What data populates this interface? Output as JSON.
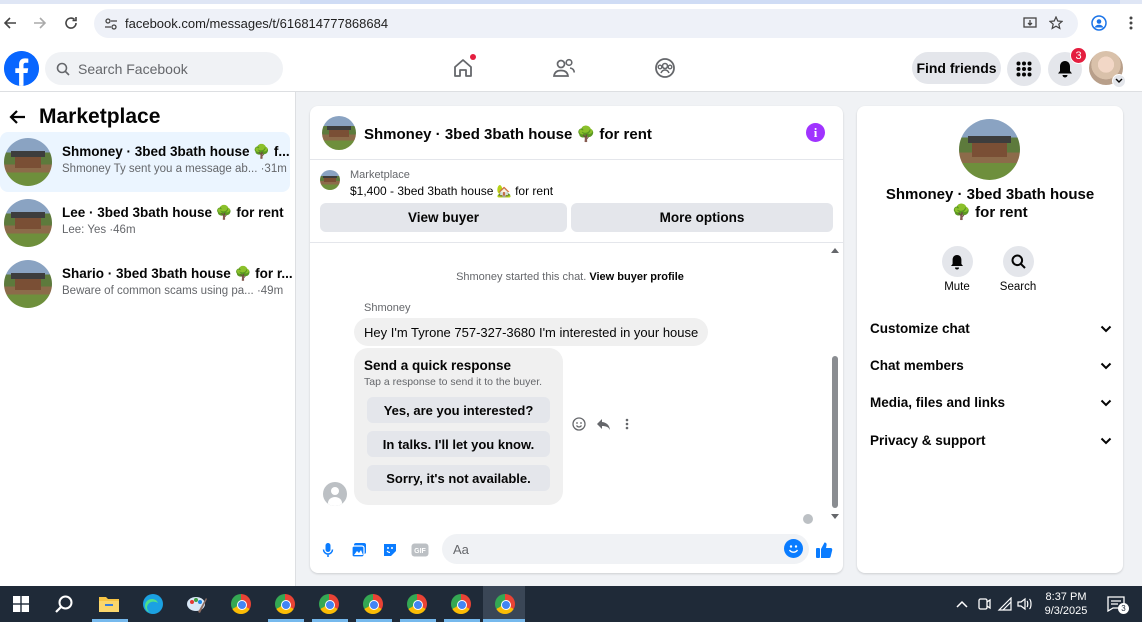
{
  "browser": {
    "url": "facebook.com/messages/t/616814777868684"
  },
  "header": {
    "search_placeholder": "Search Facebook",
    "find_friends": "Find friends",
    "notifications_count": "3"
  },
  "left_panel": {
    "title": "Marketplace",
    "chats": [
      {
        "name": "Shmoney · 3bed 3bath house 🌳 f...",
        "sub": "Shmoney Ty sent you a message ab... ·31m"
      },
      {
        "name": "Lee · 3bed 3bath house 🌳 for rent",
        "sub": "Lee: Yes ·46m"
      },
      {
        "name": "Shario · 3bed 3bath house 🌳 for r...",
        "sub": "Beware of common scams using pa... ·49m"
      }
    ]
  },
  "chat": {
    "title": "Shmoney · 3bed 3bath house 🌳 for rent",
    "marketplace_label": "Marketplace",
    "listing": "$1,400 - 3bed 3bath house 🏡 for rent",
    "view_buyer": "View buyer",
    "more_options": "More options",
    "system_msg": "Shmoney started this chat.",
    "system_link": "View buyer profile",
    "sender": "Shmoney",
    "message": "Hey I'm Tyrone 757-327-3680 I'm interested in your house",
    "quick_title": "Send a quick response",
    "quick_sub": "Tap a response to send it to the buyer.",
    "quick_responses": [
      "Yes, are you interested?",
      "In talks. I'll let you know.",
      "Sorry, it's not available."
    ],
    "composer_placeholder": "Aa"
  },
  "right_panel": {
    "title": "Shmoney · 3bed 3bath house 🌳 for rent",
    "mute": "Mute",
    "search": "Search",
    "sections": [
      "Customize chat",
      "Chat members",
      "Media, files and links",
      "Privacy & support"
    ]
  },
  "taskbar": {
    "time": "8:37 PM",
    "date": "9/3/2025",
    "notif": "3"
  },
  "colors": {
    "fb_blue": "#0866ff",
    "messenger_blue": "#0a7cff",
    "info_purple": "#a033ff",
    "badge_red": "#e41e3f"
  }
}
